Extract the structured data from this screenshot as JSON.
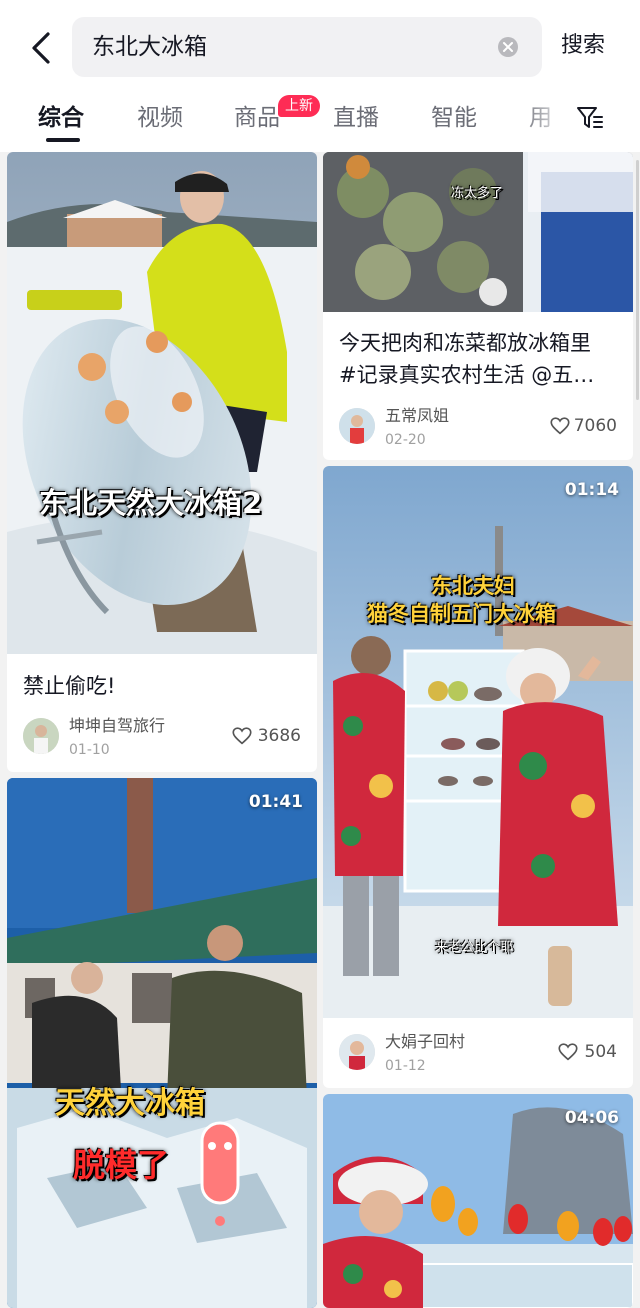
{
  "search": {
    "query": "东北大冰箱",
    "button_label": "搜索"
  },
  "tabs": [
    {
      "label": "综合",
      "active": true
    },
    {
      "label": "视频"
    },
    {
      "label": "商品",
      "badge": "上新"
    },
    {
      "label": "直播"
    },
    {
      "label": "智能"
    },
    {
      "label": "用"
    }
  ],
  "icons": {
    "back": "chevron-left-icon",
    "clear": "clear-circle-icon",
    "filter": "filter-icon",
    "like": "heart-icon"
  },
  "colors": {
    "accent": "#fe2c55",
    "text": "#161823",
    "muted": "#a0a0a0",
    "background": "#f2f2f2"
  },
  "feed": {
    "left": [
      {
        "overlay_title": "东北天然大冰箱2",
        "caption": "禁止偷吃!",
        "author": "坤坤自驾旅行",
        "date": "01-10",
        "likes": "3686"
      },
      {
        "duration": "01:41",
        "overlay_line1": "天然大冰箱",
        "overlay_line2": "脱模了"
      }
    ],
    "right": [
      {
        "overlay_text": "冻太多了",
        "caption_line1": "今天把肉和冻菜都放冰箱里",
        "caption_line2": "#记录真实农村生活 @五…",
        "author": "五常凤姐",
        "date": "02-20",
        "likes": "7060"
      },
      {
        "duration": "01:14",
        "overlay_line1": "东北夫妇",
        "overlay_line2": "猫冬自制五门大冰箱",
        "subtitle": "来老公比个耶",
        "author": "大娟子回村",
        "date": "01-12",
        "likes": "504"
      },
      {
        "duration": "04:06"
      }
    ]
  }
}
